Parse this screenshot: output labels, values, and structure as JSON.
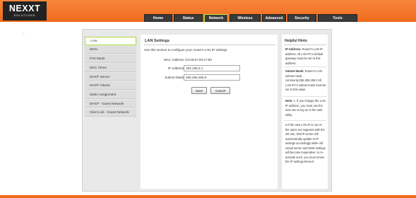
{
  "brand": {
    "name": "NEXXT",
    "tagline": "SOLUTIONS"
  },
  "nav": {
    "tabs": [
      "Home",
      "Status",
      "Network",
      "Wireless",
      "Advanced",
      "Security",
      "Tools"
    ],
    "active": "Network"
  },
  "page_mark": ".",
  "sidebar": {
    "items": [
      "LAN",
      "WAN",
      "Port Mode",
      "MAC Clone",
      "DHCP Server",
      "DHCP Clients",
      "Static Assignment",
      "DHCP - Guest Network",
      "Client List - Guest Network"
    ],
    "active": "LAN"
  },
  "lan": {
    "title": "LAN Settings",
    "description": "Use this section to configure your router's LAN IP settings.",
    "mac_label": "MAC Address",
    "mac_value": "C0:25:67:00:17:80",
    "ip_label": "IP Address",
    "ip_value": "192.168.0.1",
    "mask_label": "Subnet Mask",
    "mask_value": "255.255.255.0",
    "save": "Save",
    "cancel": "Cancel"
  },
  "hints": {
    "title": "Helpful Hints",
    "p1_bold": "IP Address:",
    "p1": " Router's LAN IP address. All LAN PC's default gateway must be set to this address.",
    "p2_bold": "Subnet Mask:",
    "p2": " Router's LAN subnet mask, commonly,255.255.255.0 All LAN PC's subnet mask must be set to this value.",
    "p3_bold": "Note:",
    "p3": " 1. If you change the LAN IP address, you must use the new one to log on to the web utility.",
    "p4": "2.If the new LAN IP is not on the same net segment with the old one, DHCP server will automatically update to IP settings accordingly while old virtual server and DMZ settings will become inoperative; to re-activate such, you must renew the IP settings thereof."
  },
  "colors": {
    "brand_orange": "#ee6b1c",
    "active_border": "#a8dc34",
    "tab_bg": "#3a3a3a"
  }
}
